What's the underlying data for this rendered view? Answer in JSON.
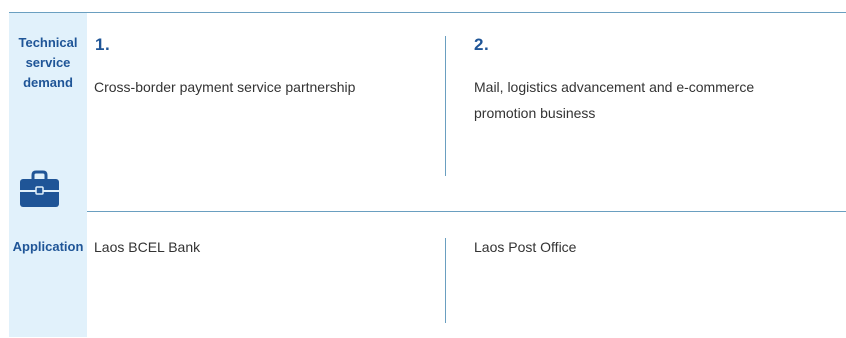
{
  "sidebar": {
    "demand_label": "Technical\nservice\ndemand",
    "application_label": "Application",
    "icon": "briefcase-icon"
  },
  "demands": [
    {
      "number": "1.",
      "text": "Cross-border payment service partnership"
    },
    {
      "number": "2.",
      "text": "Mail, logistics advancement and e-commerce promotion business"
    }
  ],
  "applications": [
    {
      "text": "Laos BCEL Bank"
    },
    {
      "text": "Laos Post Office"
    }
  ],
  "colors": {
    "accent": "#1f5597",
    "sidebar_bg": "#e1f1fb",
    "rule": "#6a9fc0",
    "text": "#333333"
  }
}
